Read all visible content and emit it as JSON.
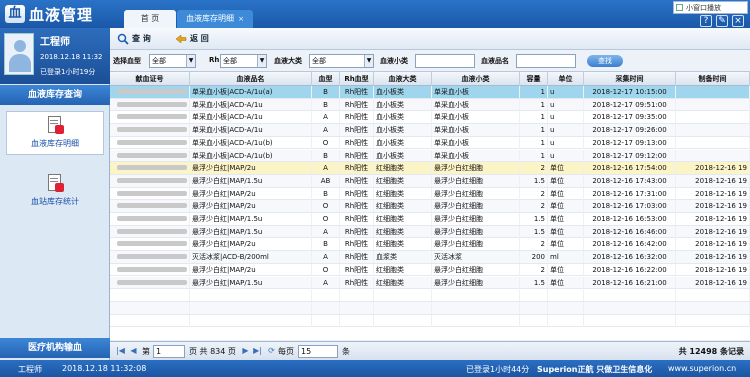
{
  "app": {
    "title": "血液管理",
    "logo_glyph": "血"
  },
  "tabs": [
    {
      "label": "首  页",
      "active": false
    },
    {
      "label": "血液库存明细",
      "active": true,
      "close": "×"
    }
  ],
  "window": {
    "mini_label": "小窗口播放",
    "help_glyph": "?",
    "edit_glyph": "✎",
    "close_glyph": "×"
  },
  "user": {
    "name": "工程师",
    "date": "2018.12.18 11:32",
    "login_info": "已登录1小时19分"
  },
  "sidebar": {
    "section_title": "血液库存查询",
    "items": [
      {
        "label": "血液库存明细",
        "active": true
      },
      {
        "label": "血站库存统计",
        "active": false
      }
    ],
    "bottom_title": "医疗机构输血"
  },
  "toolbar": {
    "query_label": "查 询",
    "back_label": "返 回"
  },
  "filters": {
    "blood_type_label": "选择血型",
    "blood_type_value": "全部",
    "rh_label": "Rh",
    "rh_value": "全部",
    "category_label": "血液大类",
    "category_value": "全部",
    "subcategory_label": "血液小类",
    "subcategory_value": "",
    "product_label": "血液品名",
    "product_value": "",
    "search_label": "查找"
  },
  "table": {
    "headers": [
      "献血证号",
      "血液品名",
      "血型",
      "Rh血型",
      "血液大类",
      "血液小类",
      "容量",
      "单位",
      "采集时间",
      "制备时间"
    ],
    "rows": [
      [
        "",
        "单采血小板|ACD-A/1u(a)",
        "B",
        "Rh阳性",
        "血小板类",
        "单采血小板",
        "1",
        "u",
        "2018-12-17 10:15:00",
        ""
      ],
      [
        "",
        "单采血小板|ACD-A/1u",
        "B",
        "Rh阳性",
        "血小板类",
        "单采血小板",
        "1",
        "u",
        "2018-12-17 09:51:00",
        ""
      ],
      [
        "",
        "单采血小板|ACD-A/1u",
        "A",
        "Rh阳性",
        "血小板类",
        "单采血小板",
        "1",
        "u",
        "2018-12-17 09:35:00",
        ""
      ],
      [
        "",
        "单采血小板|ACD-A/1u",
        "A",
        "Rh阳性",
        "血小板类",
        "单采血小板",
        "1",
        "u",
        "2018-12-17 09:26:00",
        ""
      ],
      [
        "",
        "单采血小板|ACD-A/1u(b)",
        "O",
        "Rh阳性",
        "血小板类",
        "单采血小板",
        "1",
        "u",
        "2018-12-17 09:13:00",
        ""
      ],
      [
        "",
        "单采血小板|ACD-A/1u(b)",
        "B",
        "Rh阳性",
        "血小板类",
        "单采血小板",
        "1",
        "u",
        "2018-12-17 09:12:00",
        ""
      ],
      [
        "",
        "悬浮少白红|MAP/2u",
        "A",
        "Rh阳性",
        "红细胞类",
        "悬浮少白红细胞",
        "2",
        "单位",
        "2018-12-16 17:54:00",
        "2018-12-16 19"
      ],
      [
        "",
        "悬浮少白红|MAP/1.5u",
        "AB",
        "Rh阳性",
        "红细胞类",
        "悬浮少白红细胞",
        "1.5",
        "单位",
        "2018-12-16 17:43:00",
        "2018-12-16 19"
      ],
      [
        "",
        "悬浮少白红|MAP/2u",
        "B",
        "Rh阳性",
        "红细胞类",
        "悬浮少白红细胞",
        "2",
        "单位",
        "2018-12-16 17:31:00",
        "2018-12-16 19"
      ],
      [
        "",
        "悬浮少白红|MAP/2u",
        "O",
        "Rh阳性",
        "红细胞类",
        "悬浮少白红细胞",
        "2",
        "单位",
        "2018-12-16 17:03:00",
        "2018-12-16 19"
      ],
      [
        "",
        "悬浮少白红|MAP/1.5u",
        "O",
        "Rh阳性",
        "红细胞类",
        "悬浮少白红细胞",
        "1.5",
        "单位",
        "2018-12-16 16:53:00",
        "2018-12-16 19"
      ],
      [
        "",
        "悬浮少白红|MAP/1.5u",
        "A",
        "Rh阳性",
        "红细胞类",
        "悬浮少白红细胞",
        "1.5",
        "单位",
        "2018-12-16 16:46:00",
        "2018-12-16 19"
      ],
      [
        "",
        "悬浮少白红|MAP/2u",
        "B",
        "Rh阳性",
        "红细胞类",
        "悬浮少白红细胞",
        "2",
        "单位",
        "2018-12-16 16:42:00",
        "2018-12-16 19"
      ],
      [
        "",
        "灭活冰浆|ACD-B/200ml",
        "A",
        "Rh阳性",
        "血浆类",
        "灭活冰浆",
        "200",
        "ml",
        "2018-12-16 16:32:00",
        "2018-12-16 19"
      ],
      [
        "",
        "悬浮少白红|MAP/2u",
        "O",
        "Rh阳性",
        "红细胞类",
        "悬浮少白红细胞",
        "2",
        "单位",
        "2018-12-16 16:22:00",
        "2018-12-16 19"
      ],
      [
        "",
        "悬浮少白红|MAP/1.5u",
        "A",
        "Rh阳性",
        "红细胞类",
        "悬浮少白红细胞",
        "1.5",
        "单位",
        "2018-12-16 16:21:00",
        "2018-12-16 19"
      ],
      [
        "",
        "",
        "",
        "",
        "",
        "",
        "",
        "",
        "",
        ""
      ],
      [
        "",
        "",
        "",
        "",
        "",
        "",
        "",
        "",
        "",
        ""
      ],
      [
        "",
        "",
        "",
        "",
        "",
        "",
        "",
        "",
        "",
        ""
      ]
    ]
  },
  "pager": {
    "page_prefix": "第",
    "current_page": "1",
    "page_total_text": "页 共 834 页",
    "per_page_label": "每页",
    "per_page_value": "15",
    "per_page_unit": "条",
    "total_records": "共 12498 条记录"
  },
  "status": {
    "user": "工程师",
    "datetime": "2018.12.18 11:32:08",
    "login": "已登录1小时44分",
    "brand": "Superion正航 只做卫生信息化",
    "site": "www.superion.cn"
  }
}
